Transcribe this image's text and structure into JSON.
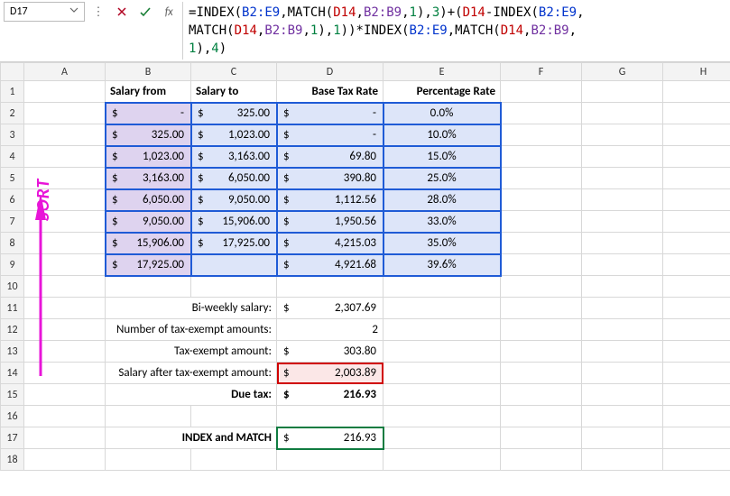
{
  "namebox": {
    "value": "D17"
  },
  "formula_tokens": [
    {
      "t": "=",
      "c": ""
    },
    {
      "t": "INDEX",
      "c": "f-name"
    },
    {
      "t": "(",
      "c": ""
    },
    {
      "t": "B2:E9",
      "c": "f-blue"
    },
    {
      "t": ",",
      "c": ""
    },
    {
      "t": "MATCH",
      "c": "f-name"
    },
    {
      "t": "(",
      "c": ""
    },
    {
      "t": "D14",
      "c": "f-red"
    },
    {
      "t": ",",
      "c": ""
    },
    {
      "t": "B2:B9",
      "c": "f-purple"
    },
    {
      "t": ",",
      "c": ""
    },
    {
      "t": "1",
      "c": "f-green"
    },
    {
      "t": "),",
      "c": ""
    },
    {
      "t": "3",
      "c": "f-green"
    },
    {
      "t": ")+(",
      "c": ""
    },
    {
      "t": "D14",
      "c": "f-red"
    },
    {
      "t": "-",
      "c": ""
    },
    {
      "t": "INDEX",
      "c": "f-name"
    },
    {
      "t": "(",
      "c": ""
    },
    {
      "t": "B2:E9",
      "c": "f-blue"
    },
    {
      "t": ",\n",
      "c": ""
    },
    {
      "t": "MATCH",
      "c": "f-name"
    },
    {
      "t": "(",
      "c": ""
    },
    {
      "t": "D14",
      "c": "f-red"
    },
    {
      "t": ",",
      "c": ""
    },
    {
      "t": "B2:B9",
      "c": "f-purple"
    },
    {
      "t": ",",
      "c": ""
    },
    {
      "t": "1",
      "c": "f-green"
    },
    {
      "t": "),",
      "c": ""
    },
    {
      "t": "1",
      "c": "f-green"
    },
    {
      "t": "))*",
      "c": ""
    },
    {
      "t": "INDEX",
      "c": "f-name"
    },
    {
      "t": "(",
      "c": ""
    },
    {
      "t": "B2:E9",
      "c": "f-blue"
    },
    {
      "t": ",",
      "c": ""
    },
    {
      "t": "MATCH",
      "c": "f-name"
    },
    {
      "t": "(",
      "c": ""
    },
    {
      "t": "D14",
      "c": "f-red"
    },
    {
      "t": ",",
      "c": ""
    },
    {
      "t": "B2:B9",
      "c": "f-purple"
    },
    {
      "t": ",\n",
      "c": ""
    },
    {
      "t": "1",
      "c": "f-green"
    },
    {
      "t": "),",
      "c": ""
    },
    {
      "t": "4",
      "c": "f-green"
    },
    {
      "t": ")",
      "c": ""
    }
  ],
  "columns": [
    "A",
    "B",
    "C",
    "D",
    "E",
    "F",
    "G",
    "H"
  ],
  "row_headers": [
    "1",
    "2",
    "3",
    "4",
    "5",
    "6",
    "7",
    "8",
    "9",
    "10",
    "11",
    "12",
    "13",
    "14",
    "15",
    "16",
    "17",
    "18"
  ],
  "headers": {
    "B": "Salary from",
    "C": "Salary to",
    "D": "Base Tax Rate",
    "E": "Percentage Rate"
  },
  "table": [
    {
      "sf": "-",
      "st": "325.00",
      "btr": "-",
      "pr": "0.0%"
    },
    {
      "sf": "325.00",
      "st": "1,023.00",
      "btr": "-",
      "pr": "10.0%"
    },
    {
      "sf": "1,023.00",
      "st": "3,163.00",
      "btr": "69.80",
      "pr": "15.0%"
    },
    {
      "sf": "3,163.00",
      "st": "6,050.00",
      "btr": "390.80",
      "pr": "25.0%"
    },
    {
      "sf": "6,050.00",
      "st": "9,050.00",
      "btr": "1,112.56",
      "pr": "28.0%"
    },
    {
      "sf": "9,050.00",
      "st": "15,906.00",
      "btr": "1,950.56",
      "pr": "33.0%"
    },
    {
      "sf": "15,906.00",
      "st": "17,925.00",
      "btr": "4,215.03",
      "pr": "35.0%"
    },
    {
      "sf": "17,925.00",
      "st": "",
      "btr": "4,921.68",
      "pr": "39.6%"
    }
  ],
  "labels": {
    "biweekly": "Bi-weekly salary:",
    "num_exempt": "Number of tax-exempt amounts:",
    "exempt_amt": "Tax-exempt amount:",
    "after_exempt": "Salary after tax-exempt amount:",
    "due_tax": "Due tax:",
    "index_match": "INDEX and MATCH"
  },
  "values": {
    "biweekly": "2,307.69",
    "num_exempt": "2",
    "exempt_amt": "303.80",
    "after_exempt": "2,003.89",
    "due_tax": "216.93",
    "index_match": "216.93"
  },
  "sort_label": "SORT",
  "currency": "$"
}
